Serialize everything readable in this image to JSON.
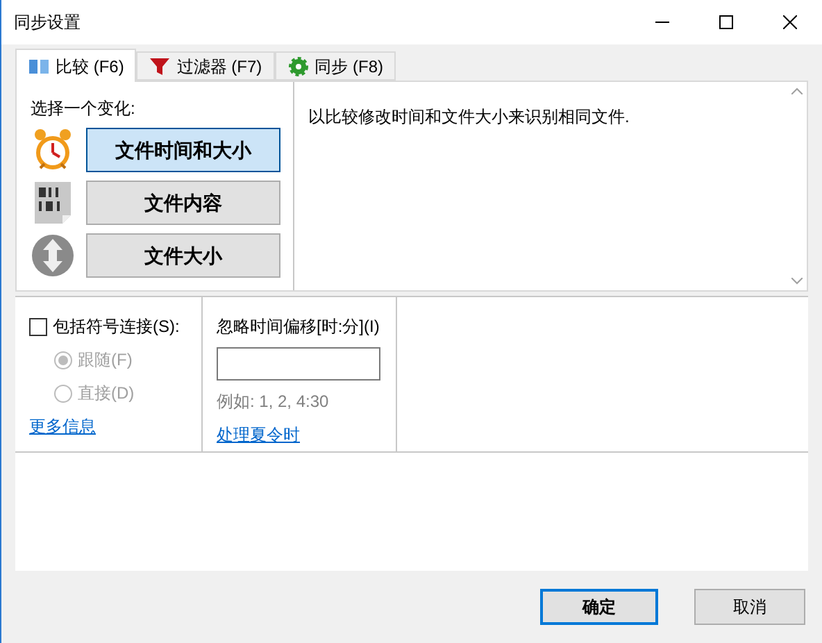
{
  "window": {
    "title": "同步设置"
  },
  "tabs": [
    {
      "label": "比较 (F6)",
      "selected": true,
      "kind": "compare"
    },
    {
      "label": "过滤器 (F7)",
      "selected": false,
      "kind": "filter"
    },
    {
      "label": "同步 (F8)",
      "selected": false,
      "kind": "sync"
    }
  ],
  "compare": {
    "heading": "选择一个变化:",
    "choices": [
      {
        "label": "文件时间和大小",
        "selected": true,
        "kind": "clock"
      },
      {
        "label": "文件内容",
        "selected": false,
        "kind": "binary"
      },
      {
        "label": "文件大小",
        "selected": false,
        "kind": "size"
      }
    ],
    "description": "以比较修改时间和文件大小来识别相同文件."
  },
  "symlinks": {
    "label": "包括符号连接(S):",
    "checked": false,
    "options": [
      {
        "label": "跟随(F)",
        "selected": true,
        "disabled": true
      },
      {
        "label": "直接(D)",
        "selected": false,
        "disabled": true
      }
    ],
    "link": "更多信息"
  },
  "time_shift": {
    "label": "忽略时间偏移[时:分](I)",
    "example": "例如: 1, 2, 4:30",
    "link": "处理夏令时"
  },
  "buttons": [
    {
      "label": "确定",
      "kind": "default"
    },
    {
      "label": "取消",
      "kind": "normal"
    }
  ]
}
